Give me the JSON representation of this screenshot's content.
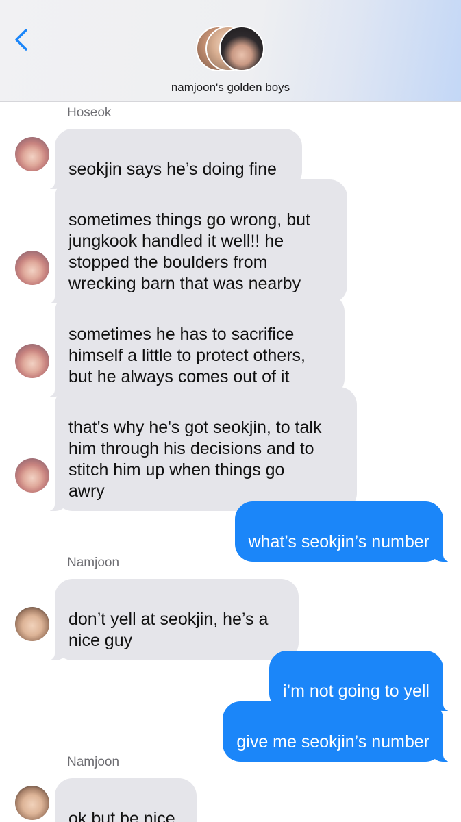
{
  "header": {
    "group_name": "namjoon's golden boys",
    "back_icon": "chevron-left-icon",
    "accent_color": "#1b86f9"
  },
  "messages": [
    {
      "type": "sender",
      "name": "Hoseok"
    },
    {
      "type": "incoming",
      "sender": "Hoseok",
      "text": "seokjin says he’s doing fine"
    },
    {
      "type": "incoming",
      "sender": "Hoseok",
      "text": "sometimes things go wrong, but\njungkook handled it well!! he\nstopped the boulders from\nwrecking barn that was nearby"
    },
    {
      "type": "incoming",
      "sender": "Hoseok",
      "text": "sometimes he has to sacrifice\nhimself a little to protect others,\nbut he always comes out of it"
    },
    {
      "type": "incoming",
      "sender": "Hoseok",
      "text": "that's why he's got seokjin, to talk\nhim through his decisions and to\nstitch him up when things go\nawry"
    },
    {
      "type": "outgoing",
      "text": "what’s seokjin’s number"
    },
    {
      "type": "sender",
      "name": "Namjoon"
    },
    {
      "type": "incoming",
      "sender": "Namjoon",
      "text": "don’t yell at seokjin, he’s a\nnice guy"
    },
    {
      "type": "outgoing",
      "text": "i’m not going to yell"
    },
    {
      "type": "outgoing",
      "text": "give me seokjin’s number"
    },
    {
      "type": "sender",
      "name": "Namjoon"
    },
    {
      "type": "incoming",
      "sender": "Namjoon",
      "text": "ok but be nice"
    }
  ],
  "colors": {
    "incoming_bubble": "#e5e5ea",
    "outgoing_bubble": "#1b86f9",
    "sender_label": "#6d6d72"
  }
}
